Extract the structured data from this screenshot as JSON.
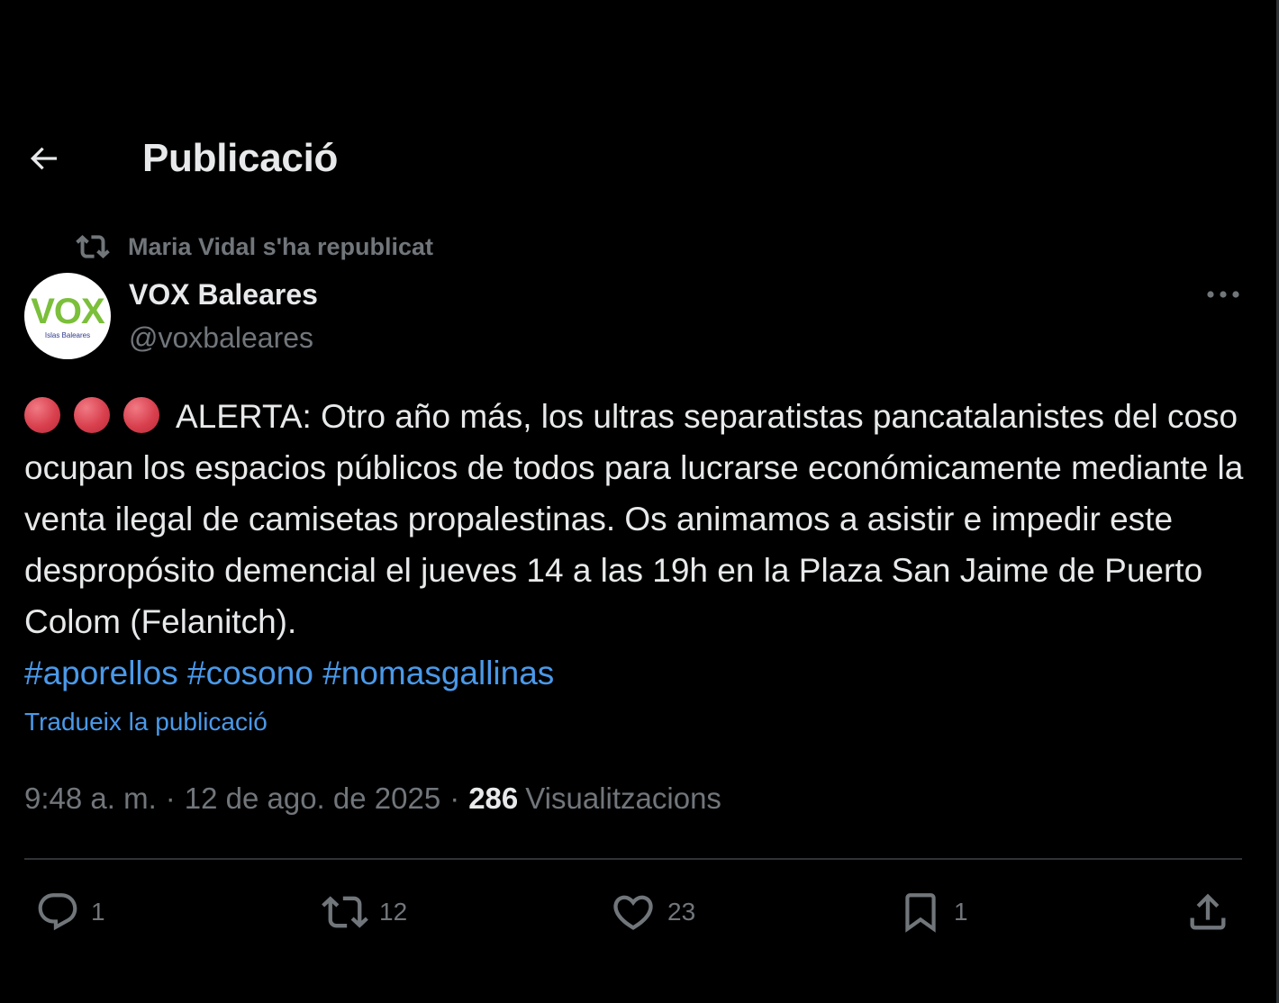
{
  "header": {
    "title": "Publicació",
    "back_icon": "arrow-left-icon"
  },
  "repost": {
    "icon": "repost-icon",
    "text": "Maria Vidal s'ha republicat"
  },
  "author": {
    "name": "VOX Baleares",
    "handle": "@voxbaleares",
    "avatar_logo_text": "VOX",
    "avatar_logo_subtext": "Islas Baleares",
    "avatar_colors": {
      "logo": "#7bbf3a",
      "subtext": "#2e3a8c"
    }
  },
  "post": {
    "text": "ALERTA: Otro año más, los ultras separatistas pancatalanistes del coso ocupan los espacios públicos de todos para lucrarse económicamente mediante la venta ilegal de camisetas propalestinas. Os animamos a asistir e impedir este despropósito demencial el jueves 14 a las 19h en la Plaza San Jaime de Puerto Colom (Felanitch).",
    "leading_emoji": "red-circle-icon",
    "hashtags": [
      "#aporellos",
      "#cosono",
      "#nomasgallinas"
    ],
    "translate_label": "Tradueix la publicació"
  },
  "meta": {
    "time": "9:48 a. m.",
    "separator": "·",
    "date": "12 de ago. de 2025",
    "views_count": "286",
    "views_label": "Visualitzacions"
  },
  "actions": {
    "replies": "1",
    "reposts": "12",
    "likes": "23",
    "bookmarks": "1"
  },
  "colors": {
    "background": "#000000",
    "text": "#e7e9ea",
    "muted": "#71767b",
    "link": "#4a99e9",
    "divider": "#2f3336",
    "alert_red": "#d9404e"
  }
}
